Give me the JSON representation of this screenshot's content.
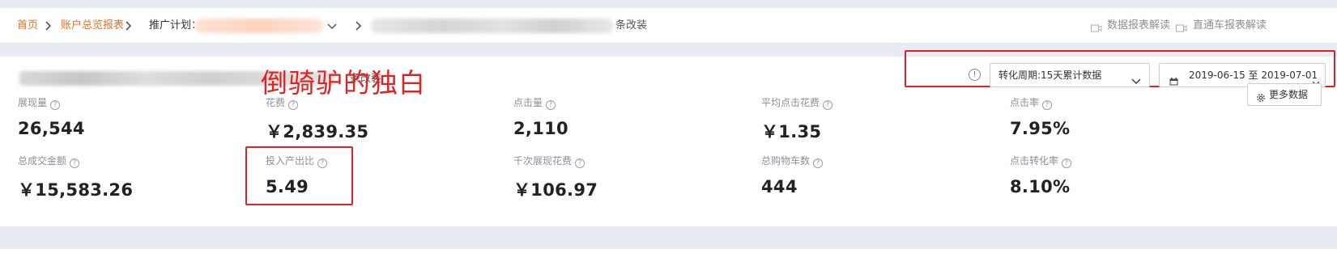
{
  "breadcrumb": {
    "home": "首页",
    "report": "账户总览报表",
    "plan_label": "推广计划：",
    "item_suffix": "条改装"
  },
  "top_links": {
    "data_report": "数据报表解读",
    "ztc_report": "直通车报表解读"
  },
  "panel": {
    "title_suffix": "条改装",
    "watermark": "倒骑驴的独白",
    "conversion_select": "转化周期:15天累计数据",
    "date_range": "2019-06-15 至 2019-07-01",
    "more_button": "更多数据"
  },
  "metrics": [
    {
      "label": "展现量",
      "value": "26,544"
    },
    {
      "label": "花费",
      "value": "￥2,839.35"
    },
    {
      "label": "点击量",
      "value": "2,110"
    },
    {
      "label": "平均点击花费",
      "value": "￥1.35"
    },
    {
      "label": "点击率",
      "value": "7.95%"
    },
    {
      "label": "总成交金额",
      "value": "￥15,583.26"
    },
    {
      "label": "投入产出比",
      "value": "5.49"
    },
    {
      "label": "千次展现花费",
      "value": "￥106.97"
    },
    {
      "label": "总购物车数",
      "value": "444"
    },
    {
      "label": "点击转化率",
      "value": "8.10%"
    }
  ],
  "icons": {
    "help": "?",
    "info": "!"
  },
  "colors": {
    "link": "#e8702a",
    "highlight": "#e02222"
  }
}
